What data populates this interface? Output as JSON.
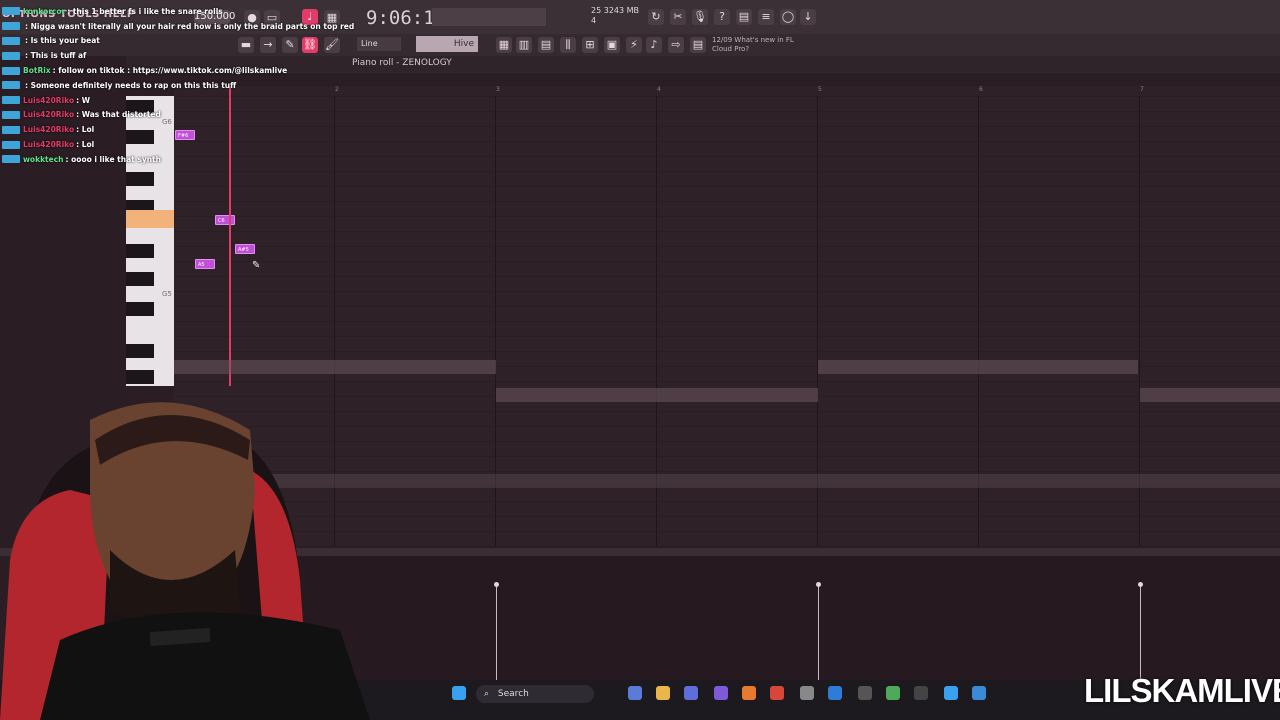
{
  "app": {
    "menu_label": "OPTIONS TOOLS HELP",
    "clock": "9:06:14",
    "tempo": "150.000",
    "cpu_line1": "25    3243 MB",
    "cpu_line2": "4",
    "snap_label": "Line",
    "pattern_label": "Hive",
    "news_line1": "12/09  What's new in FL",
    "news_line2": "Cloud Pro?",
    "piano_roll_title": "Piano roll - ZENOLOGY"
  },
  "chat": [
    {
      "user": "konkorcor",
      "text": "this 1 better fs i like the snare rolls",
      "user_color": "green"
    },
    {
      "user": "",
      "text": "Nigga wasn't literally all your hair red how is only the braid parts on top red",
      "user_color": "red"
    },
    {
      "user": "",
      "text": "Is this your beat",
      "user_color": "red"
    },
    {
      "user": "",
      "text": "This is tuff af",
      "user_color": "red"
    },
    {
      "user": "BotRix",
      "text": "follow on tiktok : https://www.tiktok.com/@lilskamlive",
      "user_color": "green"
    },
    {
      "user": "",
      "text": "Someone definitely needs to rap on this this tuff",
      "user_color": "red"
    },
    {
      "user": "Luis420Riko",
      "text": "W",
      "user_color": "red"
    },
    {
      "user": "Luis420Riko",
      "text": "Was that distorted",
      "user_color": "red"
    },
    {
      "user": "Luis420Riko",
      "text": "Lol",
      "user_color": "red"
    },
    {
      "user": "Luis420Riko",
      "text": "Lol",
      "user_color": "red"
    },
    {
      "user": "wokktech",
      "text": "oooo i like that synth",
      "user_color": "green"
    }
  ],
  "piano_roll": {
    "octave_labels": [
      "G6",
      "G5"
    ],
    "bar_numbers": [
      "2",
      "3",
      "4",
      "5",
      "6",
      "7"
    ],
    "notes": [
      {
        "label": "F#6"
      },
      {
        "label": "C6"
      },
      {
        "label": "A#5"
      },
      {
        "label": "A5"
      }
    ]
  },
  "taskbar": {
    "search_label": "Search"
  },
  "watermark": "LILSKAMLIVE",
  "colors": {
    "accent": "#e23b68",
    "note": "#c050d8",
    "highlight_key": "#f1b27b"
  }
}
